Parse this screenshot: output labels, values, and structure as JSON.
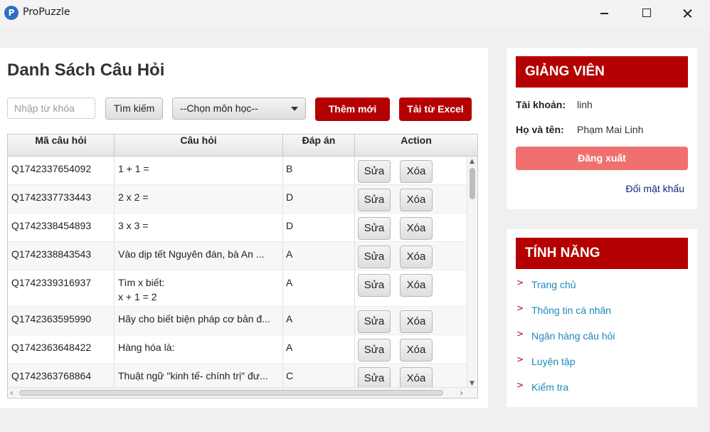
{
  "window": {
    "title": "ProPuzzle",
    "logo_letter": "P"
  },
  "main": {
    "title": "Danh Sách Câu Hỏi",
    "search_placeholder": "Nhập từ khóa",
    "search_button": "Tìm kiếm",
    "subject_select": "--Chọn môn học--",
    "add_button": "Thêm mới",
    "excel_button": "Tải từ Excel"
  },
  "table": {
    "columns": [
      "Mã câu hỏi",
      "Câu hỏi",
      "Đáp án",
      "Action"
    ],
    "edit_label": "Sửa",
    "delete_label": "Xóa",
    "rows": [
      {
        "id": "Q1742337654092",
        "question": "1 + 1 =",
        "answer": "B"
      },
      {
        "id": "Q1742337733443",
        "question": "2 x 2 =",
        "answer": "D"
      },
      {
        "id": "Q1742338454893",
        "question": "3 x 3 =",
        "answer": "D"
      },
      {
        "id": "Q1742338843543",
        "question": "Vào dịp tết Nguyên đán, bà An ...",
        "answer": "A"
      },
      {
        "id": "Q1742339316937",
        "question": "Tìm x biết:\nx + 1 = 2",
        "answer": "A"
      },
      {
        "id": "Q1742363595990",
        "question": "Hãy cho biết biện pháp cơ bản đ...",
        "answer": "A"
      },
      {
        "id": "Q1742363648422",
        "question": "Hàng hóa là:",
        "answer": "A"
      },
      {
        "id": "Q1742363768864",
        "question": "Thuật ngữ \"kinh tế- chính trị\" đư...",
        "answer": "C"
      }
    ]
  },
  "teacher": {
    "header": "GIẢNG VIÊN",
    "account_label": "Tài khoản:",
    "account_value": "linh",
    "name_label": "Họ và tên:",
    "name_value": "Phạm Mai Linh",
    "logout_button": "Đăng xuất",
    "change_password": "Đổi mật khẩu"
  },
  "features": {
    "header": "TÍNH NĂNG",
    "bullet": ">",
    "items": [
      "Trang chủ",
      "Thông tin cá nhân",
      "Ngân hàng câu hỏi",
      "Luyện tập",
      "Kiểm tra"
    ]
  },
  "colors": {
    "accent_red": "#b40000",
    "logout_red": "#f07070",
    "link_blue": "#1a8ab8"
  }
}
